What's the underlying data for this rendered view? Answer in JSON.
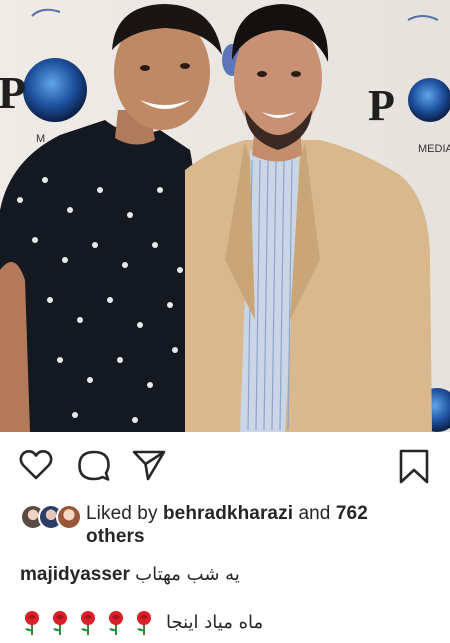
{
  "post": {
    "backdrop_text_left": "P",
    "backdrop_text_right": "PO",
    "backdrop_small_text": "MEDIA"
  },
  "actions": {
    "like_icon": "heart-outline-icon",
    "comment_icon": "comment-bubble-icon",
    "share_icon": "paper-plane-icon",
    "save_icon": "bookmark-outline-icon"
  },
  "likes": {
    "prefix": "Liked by ",
    "user": "behradkharazi",
    "middle": " and ",
    "count": "762",
    "suffix": "others"
  },
  "caption": {
    "username": "majidyasser",
    "text": "یه شب مهتاب",
    "line2": "ماه میاد اینجا",
    "emoji_count": 5,
    "emoji": "rose"
  },
  "colors": {
    "text": "#262626",
    "rose": "#d81f2a",
    "stem": "#2e8b3a"
  }
}
